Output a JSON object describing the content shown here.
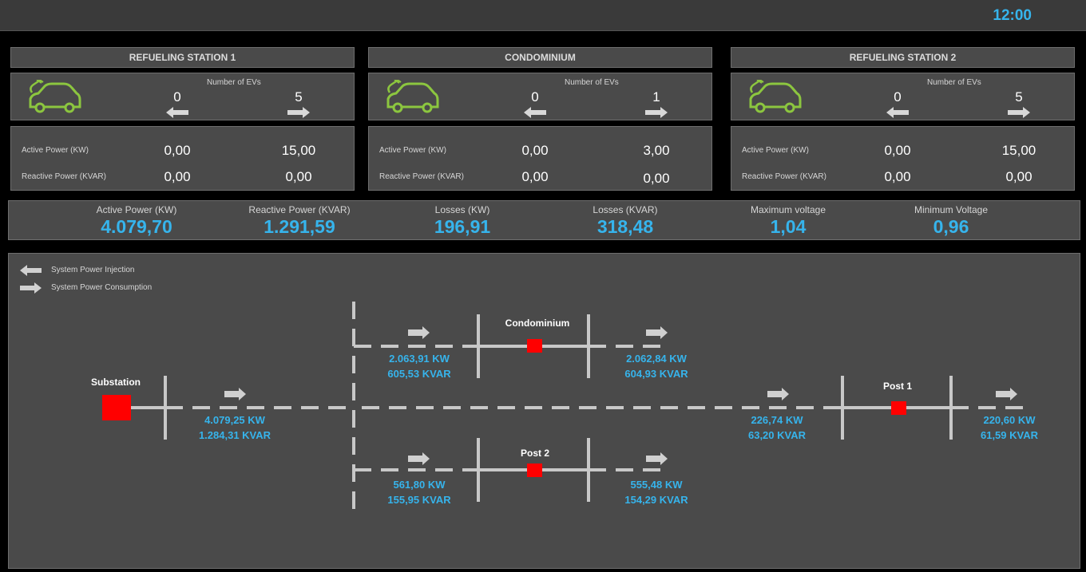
{
  "header": {
    "clock": "12:00"
  },
  "stations": [
    {
      "title": "REFUELING STATION 1",
      "ev_label": "Number of EVs",
      "ev_in": "0",
      "ev_out": "5",
      "active_label": "Active Power (KW)",
      "active_in": "0,00",
      "active_out": "15,00",
      "reactive_label": "Reactive Power (KVAR)",
      "reactive_in": "0,00",
      "reactive_out": "0,00"
    },
    {
      "title": "CONDOMINIUM",
      "ev_label": "Number of EVs",
      "ev_in": "0",
      "ev_out": "1",
      "active_label": "Active Power (KW)",
      "active_in": "0,00",
      "active_out": "3,00",
      "reactive_label": "Reactive Power (KVAR)",
      "reactive_in": "0,00",
      "reactive_out": "0,00"
    },
    {
      "title": "REFUELING STATION 2",
      "ev_label": "Number of EVs",
      "ev_in": "0",
      "ev_out": "5",
      "active_label": "Active Power (KW)",
      "active_in": "0,00",
      "active_out": "15,00",
      "reactive_label": "Reactive Power (KVAR)",
      "reactive_in": "0,00",
      "reactive_out": "0,00"
    }
  ],
  "summary": [
    {
      "label": "Active Power (KW)",
      "value": "4.079,70"
    },
    {
      "label": "Reactive Power (KVAR)",
      "value": "1.291,59"
    },
    {
      "label": "Losses (KW)",
      "value": "196,91"
    },
    {
      "label": "Losses (KVAR)",
      "value": "318,48"
    },
    {
      "label": "Maximum voltage",
      "value": "1,04"
    },
    {
      "label": "Minimum Voltage",
      "value": "0,96"
    }
  ],
  "legend": {
    "injection": "System Power Injection",
    "consumption": "System Power Consumption"
  },
  "nodes": {
    "substation": "Substation",
    "condominium": "Condominium",
    "post1": "Post 1",
    "post2": "Post 2"
  },
  "flows": {
    "substation_out": {
      "kw": "4.079,25 KW",
      "kvar": "1.284,31 KVAR"
    },
    "condo_in": {
      "kw": "2.063,91 KW",
      "kvar": "605,53 KVAR"
    },
    "condo_out": {
      "kw": "2.062,84 KW",
      "kvar": "604,93 KVAR"
    },
    "post1_in": {
      "kw": "226,74 KW",
      "kvar": "63,20 KVAR"
    },
    "post1_out": {
      "kw": "220,60 KW",
      "kvar": "61,59 KVAR"
    },
    "post2_in": {
      "kw": "561,80 KW",
      "kvar": "155,95 KVAR"
    },
    "post2_out": {
      "kw": "555,48 KW",
      "kvar": "154,29 KVAR"
    }
  },
  "colors": {
    "accent": "#36b4ec",
    "node": "#ff0000",
    "ev_icon": "#8cc63f",
    "panel": "#4a4a4a"
  },
  "icons": {
    "ev": "electric-car-icon",
    "left": "arrow-left-icon",
    "right": "arrow-right-icon"
  }
}
